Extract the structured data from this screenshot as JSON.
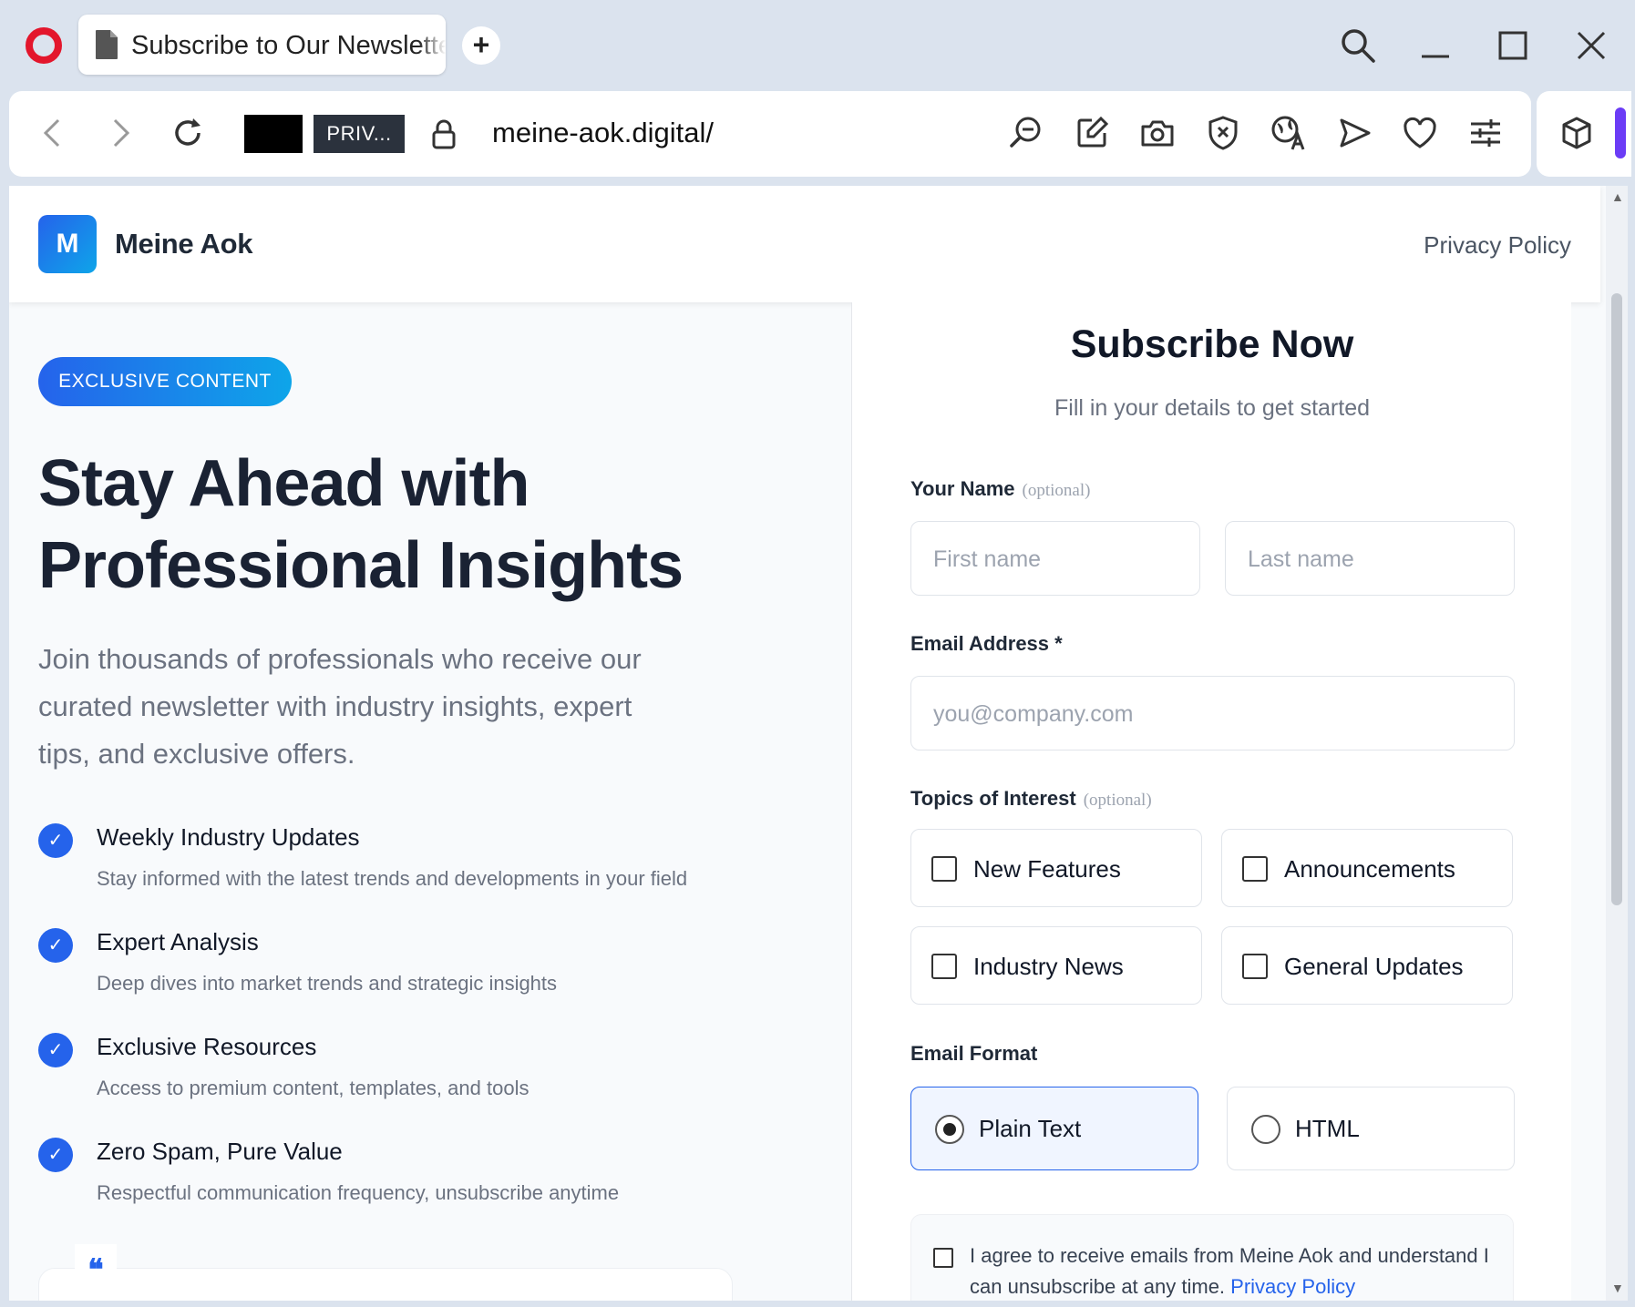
{
  "browser": {
    "tab_title": "Subscribe to Our Newsletter",
    "new_tab_label": "+",
    "private_badge": "PRIV...",
    "url": "meine-aok.digital/",
    "icons": [
      "opera-logo-icon",
      "document-icon",
      "search-icon",
      "minimize-icon",
      "maximize-icon",
      "close-icon",
      "back-icon",
      "forward-icon",
      "reload-icon",
      "lock-icon",
      "zoom-icon",
      "edit-icon",
      "camera-icon",
      "shield-icon",
      "translate-icon",
      "send-icon",
      "heart-icon",
      "settings-icon",
      "extensions-icon"
    ]
  },
  "header": {
    "logo_letter": "M",
    "site_name": "Meine Aok",
    "privacy_link": "Privacy Policy"
  },
  "hero": {
    "badge": "EXCLUSIVE CONTENT",
    "title_line1": "Stay Ahead with",
    "title_line2": "Professional Insights",
    "description": "Join thousands of professionals who receive our curated newsletter with industry insights, expert tips, and exclusive offers."
  },
  "features": [
    {
      "title": "Weekly Industry Updates",
      "desc": "Stay informed with the latest trends and developments in your field"
    },
    {
      "title": "Expert Analysis",
      "desc": "Deep dives into market trends and strategic insights"
    },
    {
      "title": "Exclusive Resources",
      "desc": "Access to premium content, templates, and tools"
    },
    {
      "title": "Zero Spam, Pure Value",
      "desc": "Respectful communication frequency, unsubscribe anytime"
    }
  ],
  "check_glyph": "✓",
  "quote_glyph": "❝",
  "form": {
    "title": "Subscribe Now",
    "subtitle": "Fill in your details to get started",
    "name_label": "Your Name",
    "optional": "(optional)",
    "first_placeholder": "First name",
    "last_placeholder": "Last name",
    "email_label": "Email Address *",
    "email_placeholder": "you@company.com",
    "topics_label": "Topics of Interest",
    "topics": [
      "New Features",
      "Announcements",
      "Industry News",
      "General Updates"
    ],
    "format_label": "Email Format",
    "formats": [
      "Plain Text",
      "HTML"
    ],
    "selected_format": "Plain Text",
    "consent_text": "I agree to receive emails from Meine Aok and understand I can unsubscribe at any time.",
    "consent_link": "Privacy Policy"
  },
  "colors": {
    "accent": "#2563eb",
    "opera_red": "#e3162c",
    "heading": "#1a2233"
  }
}
